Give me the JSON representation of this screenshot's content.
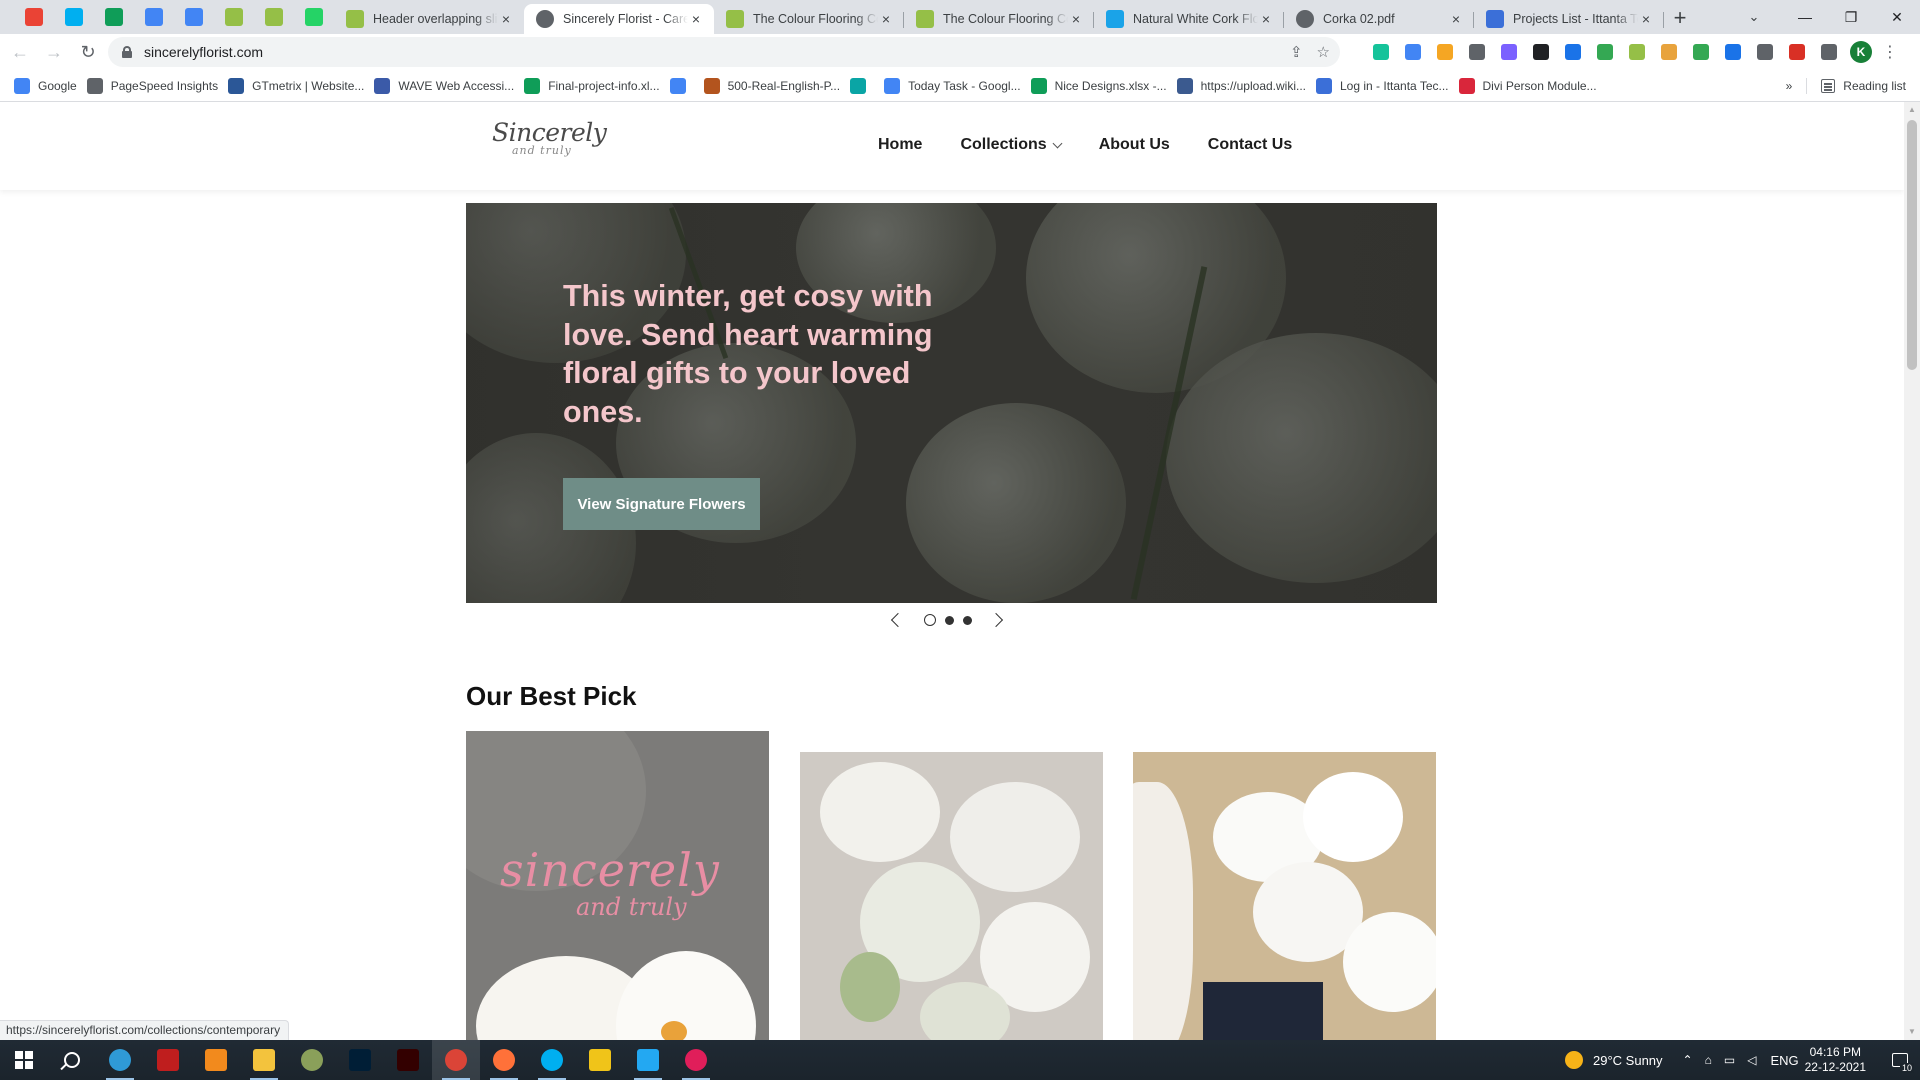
{
  "browser": {
    "pinned_tabs": [
      {
        "icon": "gmail-icon",
        "color": "#ea4335"
      },
      {
        "icon": "skype-icon",
        "color": "#00aff0"
      },
      {
        "icon": "google-sheets-icon",
        "color": "#0f9d58"
      },
      {
        "icon": "google-docs-icon",
        "color": "#4285f4"
      },
      {
        "icon": "google-docs-icon",
        "color": "#4285f4"
      },
      {
        "icon": "shopify-icon",
        "color": "#95bf47"
      },
      {
        "icon": "shopify-icon",
        "color": "#95bf47"
      },
      {
        "icon": "whatsapp-icon",
        "color": "#25d366"
      }
    ],
    "tabs": [
      {
        "title": "Header overlapping slider",
        "icon": "shopify-icon",
        "color": "#95bf47",
        "active": false
      },
      {
        "title": "Sincerely Florist - Careful",
        "icon": "globe-icon",
        "color": "#5f6368",
        "active": true
      },
      {
        "title": "The Colour Flooring Co",
        "icon": "shopify-icon",
        "color": "#95bf47",
        "active": false
      },
      {
        "title": "The Colour Flooring Co",
        "icon": "shopify-icon",
        "color": "#95bf47",
        "active": false
      },
      {
        "title": "Natural White Cork Floor",
        "icon": "bookmark-icon",
        "color": "#1aa3e8",
        "active": false
      },
      {
        "title": "Corka 02.pdf",
        "icon": "globe-icon",
        "color": "#5f6368",
        "active": false
      },
      {
        "title": "Projects List - Ittanta Tec",
        "icon": "feather-icon",
        "color": "#3b6fd8",
        "active": false
      }
    ],
    "new_tab_label": "+",
    "tab_close_glyph": "×",
    "url": "sincerelyflorist.com",
    "profile_initial": "K",
    "extensions": [
      {
        "icon": "grammarly-icon",
        "color": "#15c39a"
      },
      {
        "icon": "translate-icon",
        "color": "#4285f4"
      },
      {
        "icon": "colorzilla-icon",
        "color": "#f5a623"
      },
      {
        "icon": "wappalyzer-icon",
        "color": "#5f6368"
      },
      {
        "icon": "gradient-icon",
        "color": "#7b61ff"
      },
      {
        "icon": "bug-icon",
        "color": "#202124"
      },
      {
        "icon": "download-icon",
        "color": "#1a73e8"
      },
      {
        "icon": "glasses-icon",
        "color": "#34a853"
      },
      {
        "icon": "shopify-icon",
        "color": "#95bf47"
      },
      {
        "icon": "ruler-icon",
        "color": "#e8a33d"
      },
      {
        "icon": "tools-icon",
        "color": "#34a853"
      },
      {
        "icon": "grid-icon",
        "color": "#1a73e8"
      },
      {
        "icon": "settings-icon",
        "color": "#5f6368"
      },
      {
        "icon": "color-picker-icon",
        "color": "#d93025"
      },
      {
        "icon": "puzzle-icon",
        "color": "#5f6368"
      }
    ],
    "bookmarks": [
      {
        "label": "Google",
        "icon": "google-icon",
        "color": "#4285f4"
      },
      {
        "label": "PageSpeed Insights",
        "icon": "pagespeed-icon",
        "color": "#5f6368"
      },
      {
        "label": "GTmetrix | Website...",
        "icon": "gtmetrix-icon",
        "color": "#2b5797"
      },
      {
        "label": "WAVE Web Accessi...",
        "icon": "wave-icon",
        "color": "#3b5aa8"
      },
      {
        "label": "Final-project-info.xl...",
        "icon": "google-sheets-icon",
        "color": "#0f9d58"
      },
      {
        "label": "",
        "icon": "google-icon",
        "color": "#4285f4"
      },
      {
        "label": "500-Real-English-P...",
        "icon": "book-icon",
        "color": "#b3541e"
      },
      {
        "label": "",
        "icon": "app-icon",
        "color": "#0aa5a5"
      },
      {
        "label": "Today Task - Googl...",
        "icon": "google-icon",
        "color": "#4285f4"
      },
      {
        "label": "Nice Designs.xlsx -...",
        "icon": "google-sheets-icon",
        "color": "#0f9d58"
      },
      {
        "label": "https://upload.wiki...",
        "icon": "wikimedia-icon",
        "color": "#3b5a8f"
      },
      {
        "label": "Log in - Ittanta Tec...",
        "icon": "feather-icon",
        "color": "#3b6fd8"
      },
      {
        "label": "Divi Person Module...",
        "icon": "divi-icon",
        "color": "#d9263b"
      }
    ],
    "reading_list_label": "Reading list",
    "status_url": "https://sincerelyflorist.com/collections/contemporary"
  },
  "site": {
    "logo_main": "Sincerely",
    "logo_sub": "and truly",
    "nav": [
      "Home",
      "Collections",
      "About Us",
      "Contact Us"
    ],
    "hero": {
      "headline": "This winter, get cosy with love. Send heart warming floral gifts to your loved ones.",
      "button": "View Signature Flowers",
      "headline_color": "#f4c6cb",
      "button_color": "#6f8d87",
      "slides": 3,
      "active_slide": 1
    },
    "section_title": "Our Best Pick",
    "card1_text_main": "sincerely",
    "card1_text_sub": "and truly"
  },
  "taskbar": {
    "apps": [
      {
        "icon": "edge-icon",
        "color": "#2f9ad6"
      },
      {
        "icon": "filezilla-icon",
        "color": "#bf1e1e"
      },
      {
        "icon": "vlc-icon",
        "color": "#f28a1d"
      },
      {
        "icon": "file-explorer-icon",
        "color": "#f3c33d"
      },
      {
        "icon": "xbox-icon",
        "color": "#8aa05a"
      },
      {
        "icon": "photoshop-icon",
        "color": "#001e36"
      },
      {
        "icon": "illustrator-icon",
        "color": "#330000"
      },
      {
        "icon": "chrome-icon",
        "color": "#db4437"
      },
      {
        "icon": "firefox-icon",
        "color": "#ff7139"
      },
      {
        "icon": "skype-icon",
        "color": "#00aff0"
      },
      {
        "icon": "git-icon",
        "color": "#f0c419"
      },
      {
        "icon": "vscode-icon",
        "color": "#23a8f2"
      },
      {
        "icon": "slack-icon",
        "color": "#e01e5a"
      }
    ],
    "weather": "29°C  Sunny",
    "language": "ENG",
    "time": "04:16 PM",
    "date": "22-12-2021",
    "notification_count": "10"
  }
}
